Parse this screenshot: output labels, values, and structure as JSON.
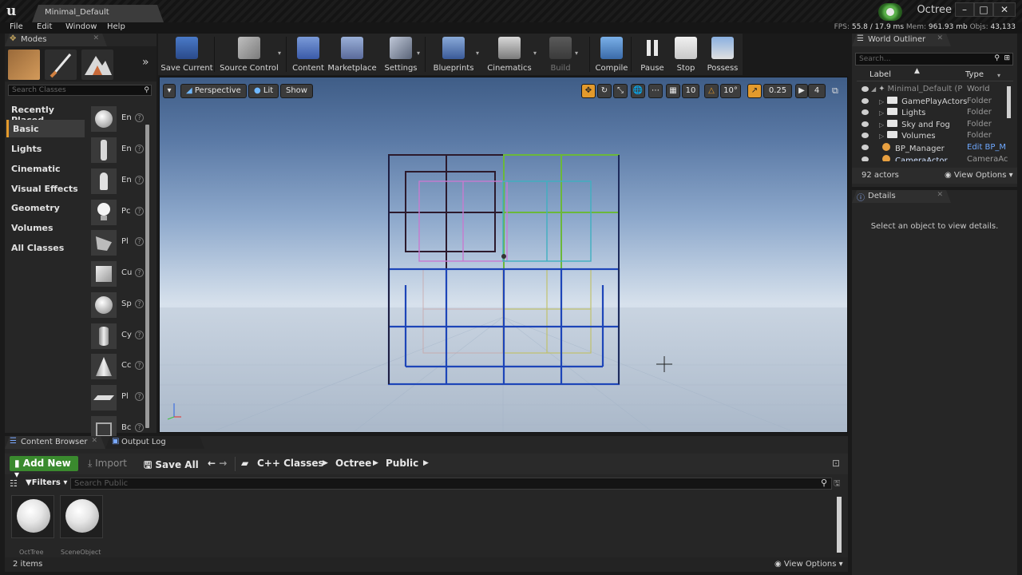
{
  "window": {
    "doc_tab": "Minimal_Default",
    "project": "Octree",
    "controls": [
      "–",
      "□",
      "✕"
    ]
  },
  "menu": [
    "File",
    "Edit",
    "Window",
    "Help"
  ],
  "stats": {
    "fps_label": "FPS:",
    "fps": "55.8 / 17.9 ms",
    "mem_label": "Mem:",
    "mem": "961.93 mb",
    "objs_label": "Objs:",
    "objs": "43,133"
  },
  "modes": {
    "tab": "Modes",
    "search_placeholder": "Search Classes",
    "categories": [
      "Recently Placed",
      "Basic",
      "Lights",
      "Cinematic",
      "Visual Effects",
      "Geometry",
      "Volumes",
      "All Classes"
    ],
    "selected_category": "Basic",
    "items": [
      {
        "label": "En",
        "icon": "sphere-icon"
      },
      {
        "label": "En",
        "icon": "figure-icon"
      },
      {
        "label": "En",
        "icon": "pawn-icon"
      },
      {
        "label": "Pc",
        "icon": "lightbulb-icon"
      },
      {
        "label": "Pl",
        "icon": "player-start-icon"
      },
      {
        "label": "Cu",
        "icon": "cube-icon"
      },
      {
        "label": "Sp",
        "icon": "sphere-icon"
      },
      {
        "label": "Cy",
        "icon": "cylinder-icon"
      },
      {
        "label": "Cc",
        "icon": "cone-icon"
      },
      {
        "label": "Pl",
        "icon": "plane-icon"
      },
      {
        "label": "Bc",
        "icon": "box-icon"
      }
    ]
  },
  "toolbar": {
    "items": [
      {
        "label": "Save Current",
        "icon": "save-icon"
      },
      {
        "label": "Source Control",
        "icon": "source-control-icon"
      },
      {
        "label": "Content",
        "icon": "content-icon"
      },
      {
        "label": "Marketplace",
        "icon": "marketplace-icon"
      },
      {
        "label": "Settings",
        "icon": "settings-icon"
      },
      {
        "label": "Blueprints",
        "icon": "blueprints-icon"
      },
      {
        "label": "Cinematics",
        "icon": "cinematics-icon"
      },
      {
        "label": "Build",
        "icon": "build-icon"
      },
      {
        "label": "Compile",
        "icon": "compile-icon"
      },
      {
        "label": "Pause",
        "icon": "pause-icon"
      },
      {
        "label": "Stop",
        "icon": "stop-icon"
      },
      {
        "label": "Possess",
        "icon": "possess-icon"
      }
    ]
  },
  "viewport": {
    "perspective": "Perspective",
    "lit": "Lit",
    "show": "Show",
    "grid_snap": "10",
    "rot_snap": "10°",
    "scale_snap": "0.25",
    "cam_speed": "4"
  },
  "outliner": {
    "tab": "World Outliner",
    "search_placeholder": "Search...",
    "col_label": "Label",
    "col_type": "Type",
    "rows": [
      {
        "label": "Minimal_Default (P",
        "type": "World"
      },
      {
        "label": "GamePlayActors",
        "type": "Folder"
      },
      {
        "label": "Lights",
        "type": "Folder"
      },
      {
        "label": "Sky and Fog",
        "type": "Folder"
      },
      {
        "label": "Volumes",
        "type": "Folder"
      },
      {
        "label": "BP_Manager",
        "type": "Edit BP_M"
      },
      {
        "label": "CameraActor",
        "type": "CameraAc"
      }
    ],
    "count": "92 actors",
    "view_options": "View Options"
  },
  "details": {
    "tab": "Details",
    "empty": "Select an object to view details."
  },
  "content_browser": {
    "tab": "Content Browser",
    "tab2": "Output Log",
    "add_new": "Add New",
    "import": "Import",
    "save_all": "Save All",
    "path": [
      "C++ Classes",
      "Octree",
      "Public"
    ],
    "filters": "Filters",
    "search_placeholder": "Search Public",
    "assets": [
      "OctTree",
      "SceneObject"
    ],
    "count": "2 items",
    "view_options": "View Options"
  },
  "colors": {
    "accent": "#e39a2c",
    "add_new": "#3a8a2e"
  }
}
